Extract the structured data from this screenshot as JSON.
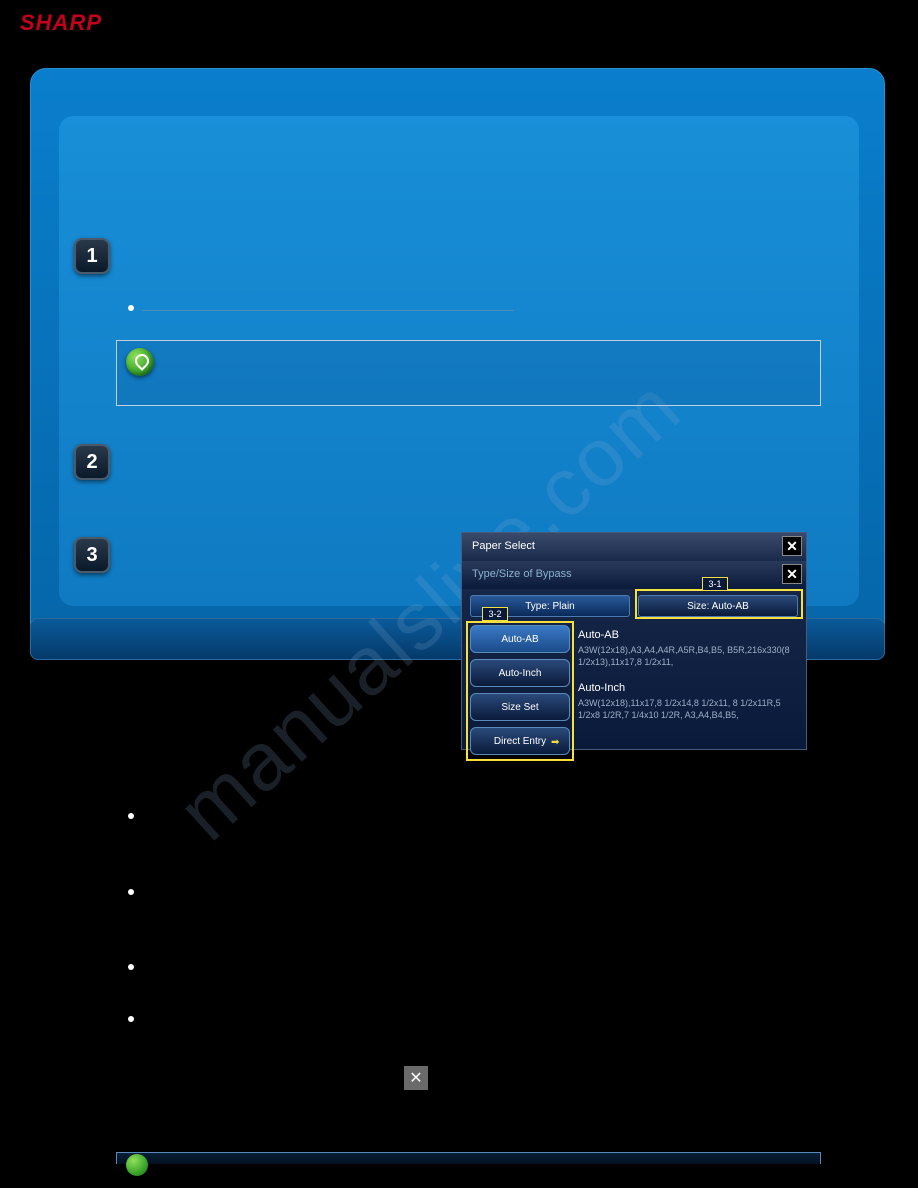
{
  "brand": "SHARP",
  "steps": {
    "s1": "1",
    "s2": "2",
    "s3": "3"
  },
  "ui": {
    "paper_select": "Paper Select",
    "type_size_bypass": "Type/Size of Bypass",
    "type_label": "Type:  Plain",
    "size_label": "Size:  Auto-AB",
    "callout_31": "3-1",
    "callout_32": "3-2",
    "options": {
      "auto_ab": "Auto-AB",
      "auto_inch": "Auto-Inch",
      "size_set": "Size Set",
      "direct_entry": "Direct Entry"
    },
    "info": {
      "heading_ab": "Auto-AB",
      "text_ab": "A3W(12x18),A3,A4,A4R,A5R,B4,B5, B5R,216x330(8 1/2x13),11x17,8 1/2x11,",
      "heading_inch": "Auto-Inch",
      "text_inch": "A3W(12x18),11x17,8 1/2x14,8 1/2x11, 8 1/2x11R,5 1/2x8 1/2R,7 1/4x10 1/2R, A3,A4,B4,B5,"
    }
  },
  "page_close": "✕",
  "watermark": "manualslive.com"
}
